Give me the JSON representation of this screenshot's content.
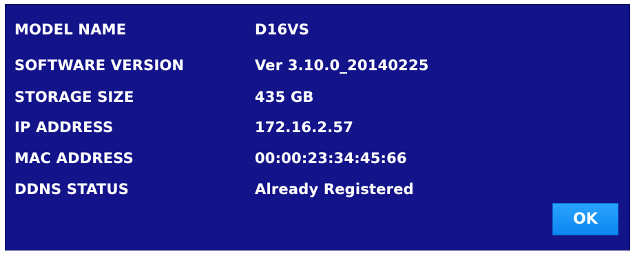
{
  "system_info": {
    "rows": [
      {
        "label": "MODEL NAME",
        "value": "D16VS"
      },
      {
        "label": "SOFTWARE VERSION",
        "value": "Ver 3.10.0_20140225"
      },
      {
        "label": "STORAGE SIZE",
        "value": "435 GB"
      },
      {
        "label": "IP ADDRESS",
        "value": "172.16.2.57"
      },
      {
        "label": "MAC ADDRESS",
        "value": "00:00:23:34:45:66"
      },
      {
        "label": "DDNS STATUS",
        "value": "Already Registered"
      }
    ]
  },
  "dialog": {
    "ok_label": "OK"
  },
  "colors": {
    "panel_background": "#13138a",
    "button_background": "#1a96f8",
    "text": "#ffffff"
  }
}
